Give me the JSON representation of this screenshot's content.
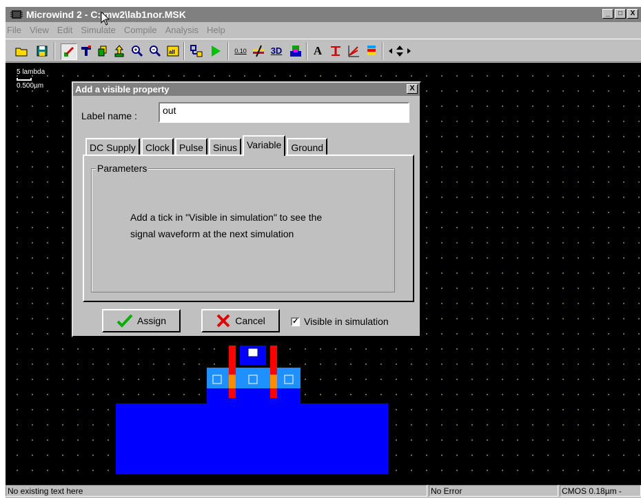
{
  "window": {
    "title": "Microwind 2 - C:\\mw2\\lab1nor.MSK",
    "minimize": "_",
    "maximize": "□",
    "close": "X"
  },
  "menu": [
    "File",
    "View",
    "Edit",
    "Simulate",
    "Compile",
    "Analysis",
    "Help"
  ],
  "toolbar": {
    "text_tool": "A",
    "pos_label": "0.10",
    "view3d": "3D"
  },
  "canvas": {
    "scale_label": "5 lambda",
    "scale_value": "0.500µm"
  },
  "dialog": {
    "title": "Add a visible property",
    "close": "X",
    "label_name_caption": "Label name :",
    "label_name_value": "out",
    "tabs": [
      "DC Supply",
      "Clock",
      "Pulse",
      "Sinus",
      "Variable",
      "Ground"
    ],
    "active_tab": "Variable",
    "group_title": "Parameters",
    "message_line1": "Add a tick in  \"Visible in simulation\" to see the",
    "message_line2": "signal waveform at the next simulation",
    "assign_label": "Assign",
    "cancel_label": "Cancel",
    "visible_checkbox_label": "Visible in simulation",
    "visible_checked": true
  },
  "status": {
    "left": "No existing text here",
    "middle": "No Error",
    "right": "CMOS 0.18µm -"
  },
  "colors": {
    "diffusion": "#0000ff",
    "poly": "#ff0000",
    "contact_fill": "#1e90ff",
    "grid_dot": "#7a7a3a"
  }
}
